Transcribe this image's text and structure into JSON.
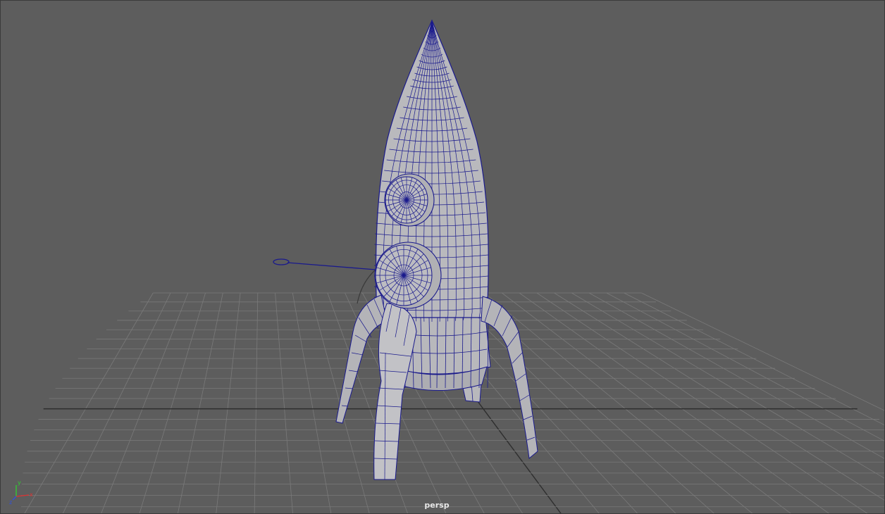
{
  "viewport": {
    "camera_label": "persp",
    "background_color": "#5d5d5d",
    "grid_color": "#7a7a7a",
    "grid_axis_color": "#2e2e2e",
    "wire_color": "#1a1a8c",
    "surface_color": "#b8b8bc"
  },
  "axis_gizmo": {
    "x_label": "x",
    "y_label": "y",
    "z_label": "z",
    "x_color": "#e03030",
    "y_color": "#30d030",
    "z_color": "#3050e0"
  },
  "scene": {
    "objects": [
      "rocket-body",
      "porthole-upper",
      "porthole-lower",
      "rocket-fin-left",
      "rocket-fin-front",
      "rocket-fin-right",
      "rocket-fin-back",
      "rocket-skirt",
      "locator"
    ]
  }
}
